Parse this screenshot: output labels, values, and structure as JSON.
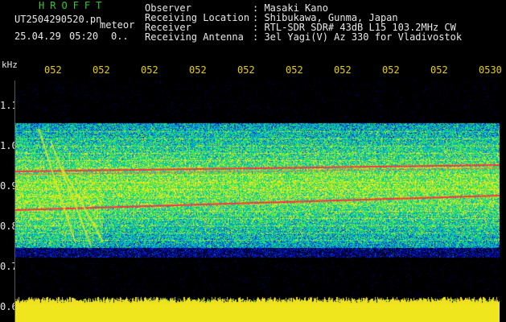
{
  "header": {
    "brand": "HROFFT",
    "filename": "UT2504290520.pn",
    "mode": "meteor",
    "date": "25.04.29",
    "time": "05:20",
    "status": "0..",
    "info": [
      {
        "label": "Observer",
        "value": ": Masaki Kano"
      },
      {
        "label": "Receiving Location",
        "value": ": Shibukawa, Gunma, Japan"
      },
      {
        "label": "Receiver",
        "value": ": RTL-SDR SDR# 43dB L15 103.2MHz CW"
      },
      {
        "label": "Receiving Antenna",
        "value": ": 3el Yagi(V) Az 330 for Vladivostok"
      }
    ]
  },
  "axes": {
    "unit": "kHz",
    "x_ticks": [
      "052",
      "052",
      "052",
      "052",
      "052",
      "052",
      "052",
      "052",
      "052",
      "0530"
    ],
    "y_ticks": [
      "1.1",
      "1.0",
      "0.9",
      "0.8",
      "0.7",
      "0.6"
    ]
  },
  "colors": {
    "background": "#000000",
    "signal_yellow": "#f0e020",
    "carrier_red": "#ff3040",
    "text": "#e8e8e8",
    "brand": "#2ecc2e",
    "tick_x": "#e8d000"
  }
}
